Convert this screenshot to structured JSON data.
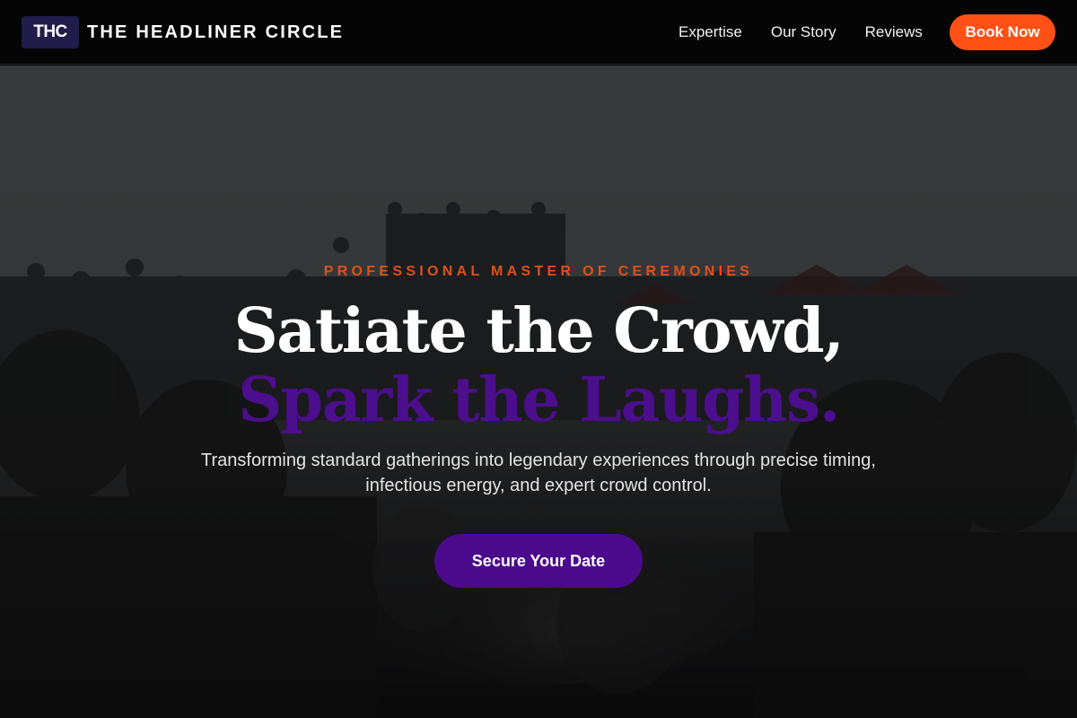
{
  "nav": {
    "logo_badge": "THC",
    "brand_name": "THE HEADLINER CIRCLE",
    "links": [
      "Expertise",
      "Our Story",
      "Reviews"
    ],
    "cta_label": "Book Now",
    "cta_color": "#ff5116"
  },
  "hero": {
    "eyebrow": "PROFESSIONAL MASTER OF CEREMONIES",
    "headline_line1": "Satiate the Crowd,",
    "headline_line2": "Spark the Laughs.",
    "subtitle": "Transforming standard gatherings into legendary experiences through precise timing, infectious energy, and expert crowd control.",
    "cta_label": "Secure Your Date",
    "background_image": "crowd-photo",
    "colors": {
      "eyebrow": "#e0501a",
      "headline_accent": "#4b0e8c",
      "cta": "#4b0a8c"
    }
  }
}
